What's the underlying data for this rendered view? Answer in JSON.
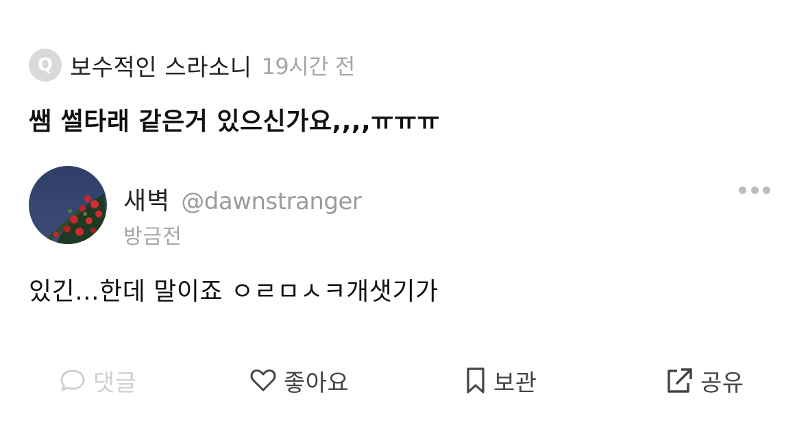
{
  "question": {
    "badge": "Q",
    "author": "보수적인 스라소니",
    "time": "19시간 전",
    "text": "쌤 썰타래 같은거 있으신가요,,,,ㅠㅠㅠ"
  },
  "answer": {
    "avatar_icon": "rose-photo-avatar",
    "nickname": "새벽",
    "handle": "@dawnstranger",
    "time": "방금전",
    "text": "있긴...한데 말이죠 ㅇㄹㅁㅅㅋ개샛기가"
  },
  "actions": {
    "comment": "댓글",
    "like": "좋아요",
    "save": "보관",
    "share": "공유"
  },
  "colors": {
    "muted": "#a6a6a6",
    "disabled": "#cfcfcf",
    "text": "#111111"
  }
}
